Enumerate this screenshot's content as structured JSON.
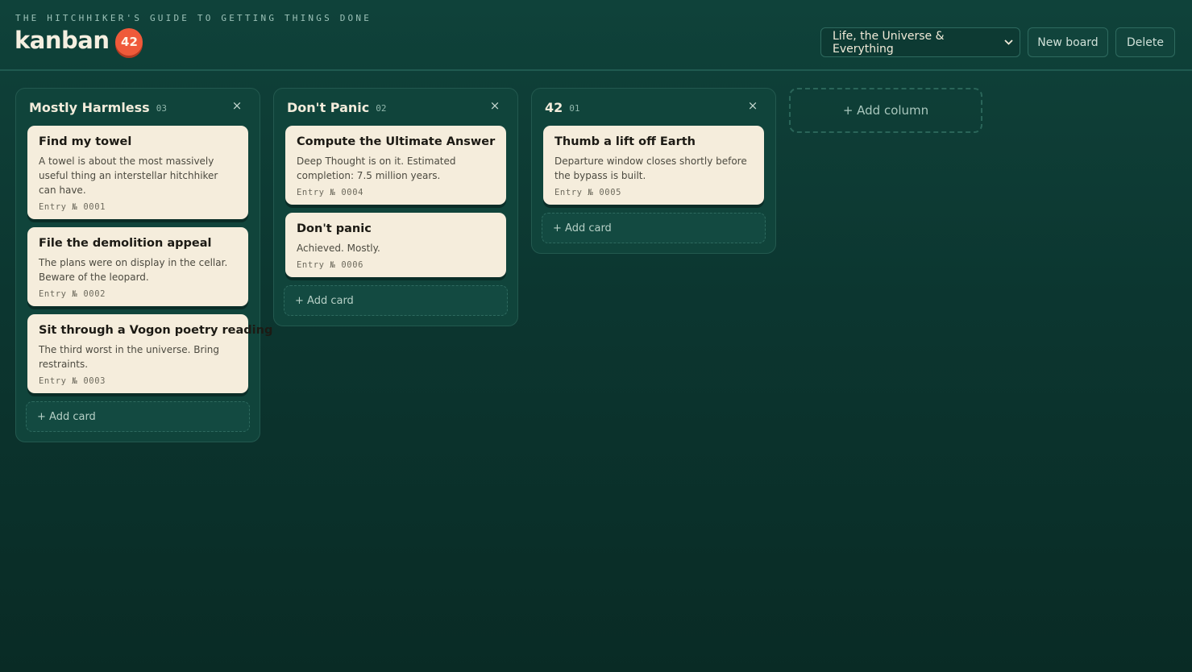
{
  "header": {
    "tagline": "THE HITCHHIKER'S GUIDE TO GETTING THINGS DONE",
    "brand": "kanban",
    "badge": "42",
    "board_select": "Life, the Universe & Everything",
    "new_board_label": "New board",
    "delete_label": "Delete"
  },
  "columns": [
    {
      "title": "Mostly Harmless",
      "count": "03",
      "close": "×",
      "cards": [
        {
          "title": "Find my towel",
          "desc": "A towel is about the most massively useful thing an interstellar hitchhiker can have.",
          "entry": "Entry № 0001"
        },
        {
          "title": "File the demolition appeal",
          "desc": "The plans were on display in the cellar. Beware of the leopard.",
          "entry": "Entry № 0002"
        },
        {
          "title": "Sit through a Vogon poetry reading",
          "desc": "The third worst in the universe. Bring restraints.",
          "entry": "Entry № 0003"
        }
      ],
      "add_card": "+ Add card"
    },
    {
      "title": "Don't Panic",
      "count": "02",
      "close": "×",
      "cards": [
        {
          "title": "Compute the Ultimate Answer",
          "desc": "Deep Thought is on it. Estimated completion: 7.5 million years.",
          "entry": "Entry № 0004"
        },
        {
          "title": "Don't panic",
          "desc": "Achieved. Mostly.",
          "entry": "Entry № 0006"
        }
      ],
      "add_card": "+ Add card"
    },
    {
      "title": "42",
      "count": "01",
      "close": "×",
      "cards": [
        {
          "title": "Thumb a lift off Earth",
          "desc": "Departure window closes shortly before the bypass is built.",
          "entry": "Entry № 0005"
        }
      ],
      "add_card": "+ Add card"
    }
  ],
  "add_column": "+ Add column"
}
